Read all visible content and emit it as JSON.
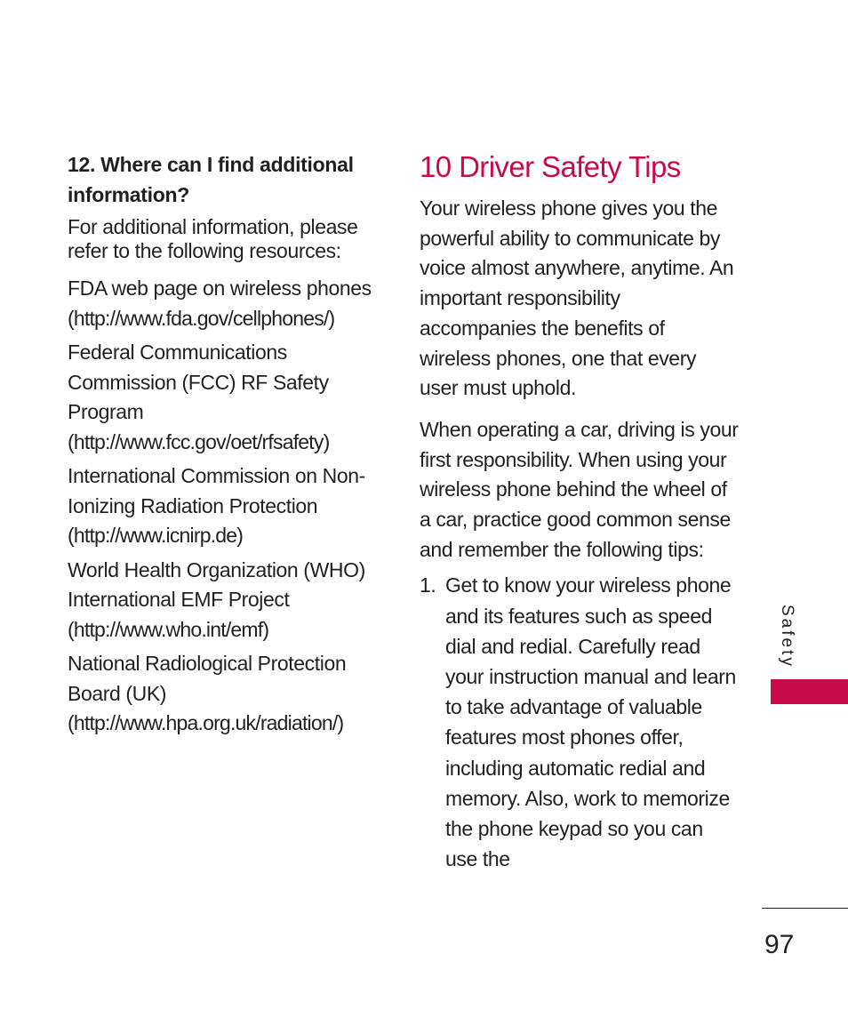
{
  "left_column": {
    "question_heading": "12. Where can I find additional information?",
    "intro": "For additional information, please refer to the following resources:",
    "resources": [
      {
        "name": "FDA web page on wireless phones",
        "url": "(http://www.fda.gov/cellphones/)"
      },
      {
        "name": "Federal Communications Commission (FCC) RF Safety Program",
        "url": "(http://www.fcc.gov/oet/rfsafety)"
      },
      {
        "name": "International Commission on Non-Ionizing Radiation Protection",
        "url": "(http://www.icnirp.de)"
      },
      {
        "name": "World Health Organization (WHO) International EMF Project",
        "url": "(http://www.who.int/emf)"
      },
      {
        "name": "National Radiological Protection Board (UK)",
        "url": "(http://www.hpa.org.uk/radiation/)"
      }
    ]
  },
  "right_column": {
    "title": "10 Driver Safety Tips",
    "paragraphs": [
      "Your wireless phone gives you the powerful ability to communicate by voice almost anywhere, anytime. An important responsibility accompanies the benefits of wireless phones, one that every user must uphold.",
      "When operating a car, driving is your first responsibility. When using your wireless phone behind the wheel of a car, practice good common sense and remember the following tips:"
    ],
    "tips": [
      {
        "number": "1.",
        "text": "Get to know your wireless phone and its features such as speed dial and redial. Carefully read your instruction manual and learn to take advantage of valuable features most phones offer, including automatic redial and memory. Also, work to memorize the phone keypad so you can use the"
      }
    ]
  },
  "sidebar": {
    "section_label": "Safety",
    "accent_color": "#c8094a"
  },
  "footer": {
    "page_number": "97"
  }
}
